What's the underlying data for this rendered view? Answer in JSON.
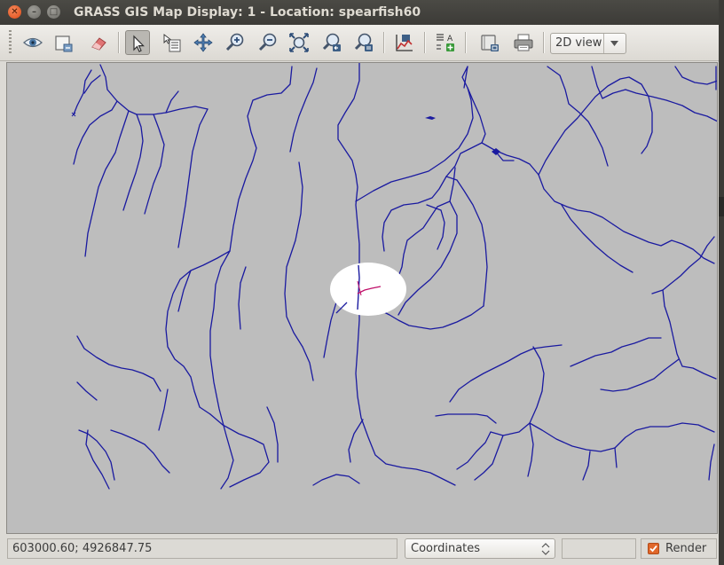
{
  "window": {
    "title": "GRASS GIS Map Display: 1  - Location: spearfish60"
  },
  "toolbar": {
    "buttons": [
      {
        "name": "display-map",
        "icon": "eye-icon"
      },
      {
        "name": "render-map",
        "icon": "render-map-icon"
      },
      {
        "name": "erase",
        "icon": "eraser-icon"
      },
      {
        "name": "pointer",
        "icon": "pointer-icon",
        "active": true
      },
      {
        "name": "query",
        "icon": "query-icon"
      },
      {
        "name": "pan",
        "icon": "pan-icon"
      },
      {
        "name": "zoom-in",
        "icon": "zoom-in-icon"
      },
      {
        "name": "zoom-out",
        "icon": "zoom-out-icon"
      },
      {
        "name": "zoom-extent",
        "icon": "zoom-extent-icon"
      },
      {
        "name": "zoom-back",
        "icon": "zoom-back-icon"
      },
      {
        "name": "zoom-menu",
        "icon": "zoom-menu-icon"
      },
      {
        "name": "analyze",
        "icon": "analyze-icon"
      },
      {
        "name": "overlay",
        "icon": "overlay-icon"
      },
      {
        "name": "save-image",
        "icon": "save-image-icon"
      },
      {
        "name": "print",
        "icon": "printer-icon"
      }
    ],
    "view_mode": "2D view"
  },
  "map": {
    "background": "#bdbdbd",
    "stream_color": "#1a1aa0",
    "highlight_color": "#c0106a",
    "mask_color": "#ffffff"
  },
  "statusbar": {
    "coordinates": "603000.60; 4926847.75",
    "mode": "Coordinates",
    "render_label": "Render",
    "render_checked": true
  }
}
